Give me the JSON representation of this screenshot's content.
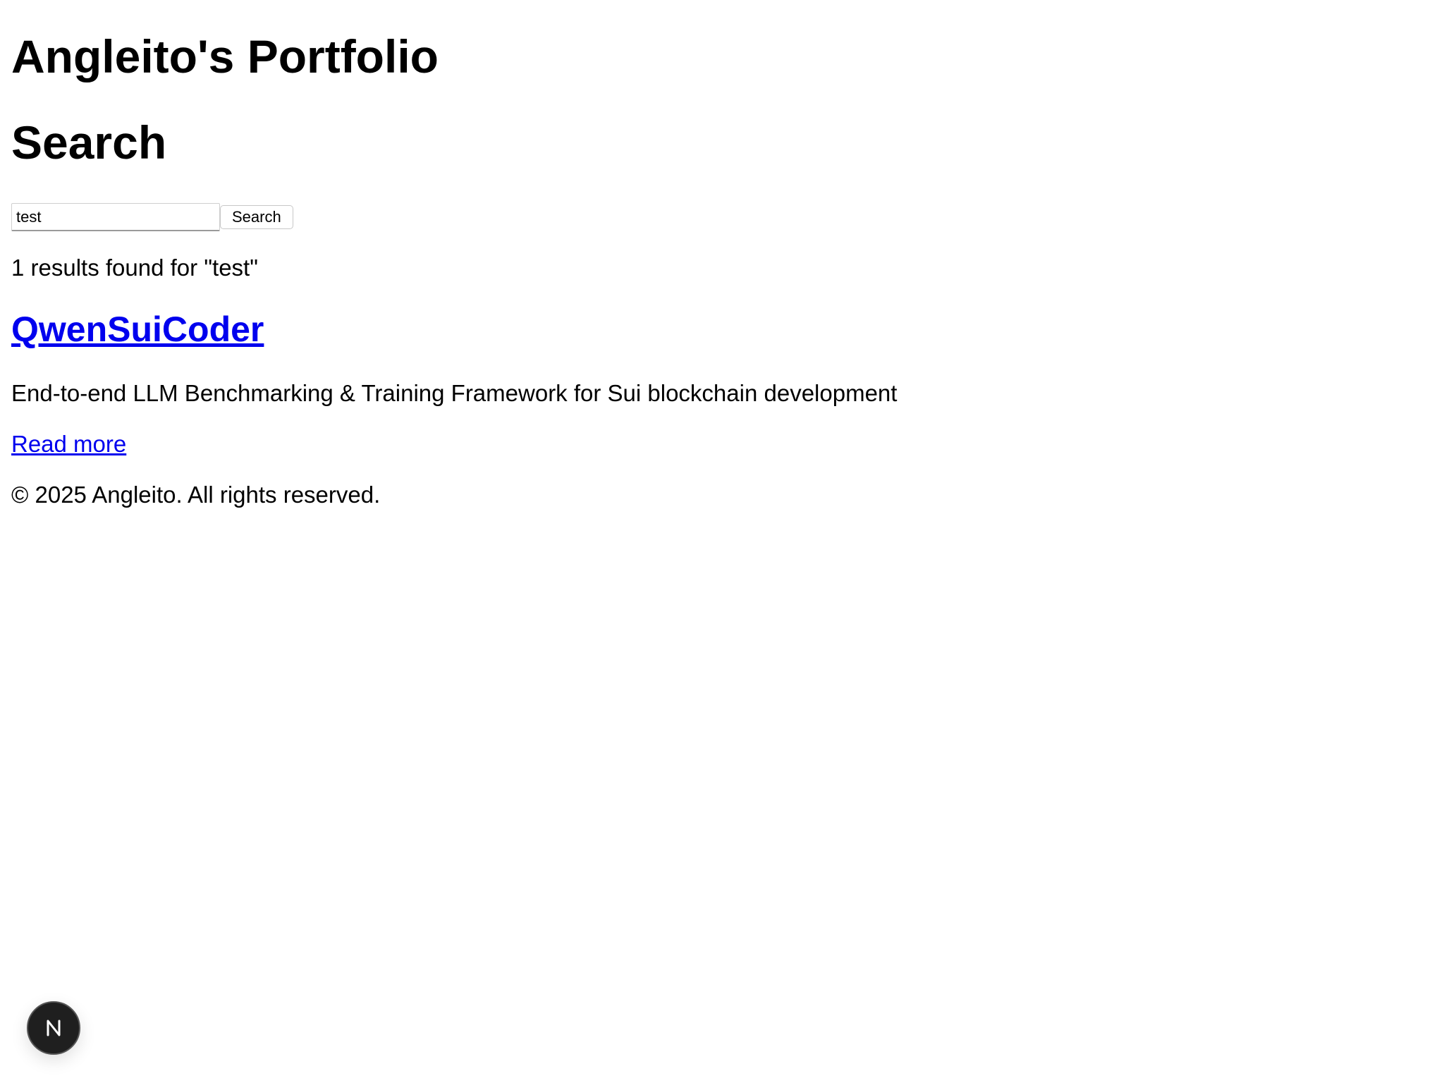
{
  "header": {
    "site_title": "Angleito's Portfolio"
  },
  "search": {
    "heading": "Search",
    "input_value": "test",
    "button_label": "Search"
  },
  "results": {
    "summary": "1 results found for \"test\"",
    "items": [
      {
        "title": "QwenSuiCoder",
        "description": "End-to-end LLM Benchmarking & Training Framework for Sui blockchain development",
        "read_more_label": "Read more"
      }
    ]
  },
  "footer": {
    "copyright": "© 2025 Angleito. All rights reserved."
  },
  "dev_badge": {
    "icon": "nextjs-icon",
    "letter": "N"
  },
  "colors": {
    "link": "#0000ee",
    "badge_bg": "#1f1f1f"
  }
}
